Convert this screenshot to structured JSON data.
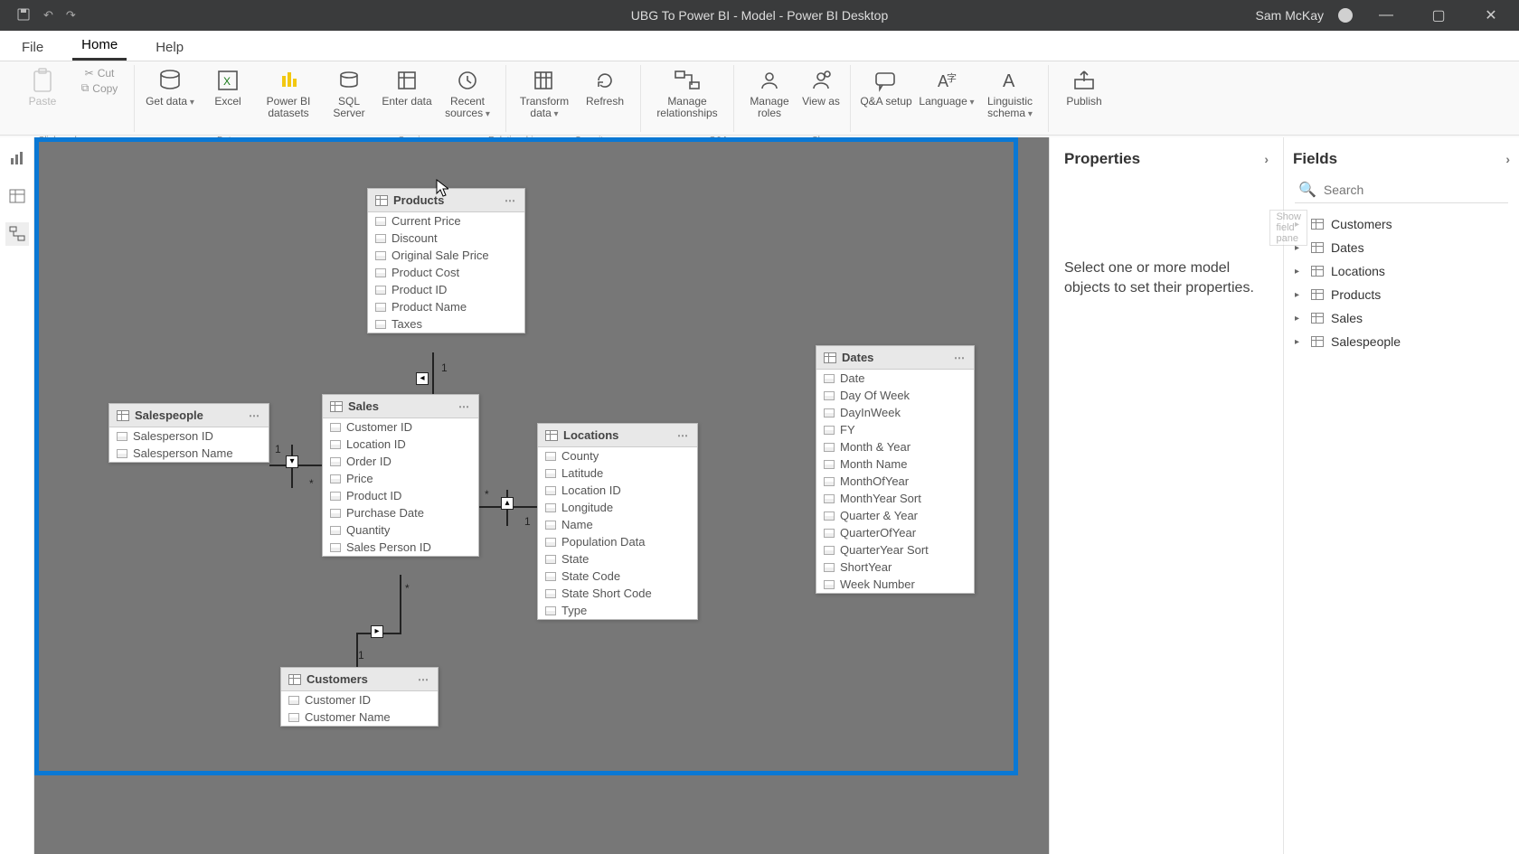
{
  "titlebar": {
    "title": "UBG To Power BI - Model - Power BI Desktop",
    "user": "Sam McKay"
  },
  "menu": {
    "file": "File",
    "home": "Home",
    "help": "Help"
  },
  "ribbon": {
    "clipboard": {
      "paste": "Paste",
      "cut": "Cut",
      "copy": "Copy"
    },
    "getdata": "Get data",
    "excel": "Excel",
    "pbdatasets": "Power BI datasets",
    "sqlserver": "SQL Server",
    "enterdata": "Enter data",
    "recentsources": "Recent sources",
    "transformdata": "Transform data",
    "refresh": "Refresh",
    "managerel": "Manage relationships",
    "manageroles": "Manage roles",
    "viewas": "View as",
    "qasetup": "Q&A setup",
    "language": "Language",
    "linguistic": "Linguistic schema",
    "publish": "Publish",
    "groups": {
      "clipboard": "Clipboard",
      "data": "Data",
      "queries": "Queries",
      "relationships": "Relationships",
      "security": "Security",
      "qa": "Q&A",
      "share": "Share"
    }
  },
  "tables": {
    "products": {
      "title": "Products",
      "fields": [
        "Current Price",
        "Discount",
        "Original Sale Price",
        "Product Cost",
        "Product ID",
        "Product Name",
        "Taxes"
      ]
    },
    "salespeople": {
      "title": "Salespeople",
      "fields": [
        "Salesperson ID",
        "Salesperson Name"
      ]
    },
    "sales": {
      "title": "Sales",
      "fields": [
        "Customer ID",
        "Location ID",
        "Order ID",
        "Price",
        "Product ID",
        "Purchase Date",
        "Quantity",
        "Sales Person ID"
      ]
    },
    "locations": {
      "title": "Locations",
      "fields": [
        "County",
        "Latitude",
        "Location ID",
        "Longitude",
        "Name",
        "Population Data",
        "State",
        "State Code",
        "State Short Code",
        "Type"
      ]
    },
    "dates": {
      "title": "Dates",
      "fields": [
        "Date",
        "Day Of Week",
        "DayInWeek",
        "FY",
        "Month & Year",
        "Month Name",
        "MonthOfYear",
        "MonthYear Sort",
        "Quarter & Year",
        "QuarterOfYear",
        "QuarterYear Sort",
        "ShortYear",
        "Week Number"
      ]
    },
    "customers": {
      "title": "Customers",
      "fields": [
        "Customer ID",
        "Customer Name"
      ]
    }
  },
  "rel_marks": {
    "one": "1",
    "many": "*"
  },
  "properties": {
    "title": "Properties",
    "body": "Select one or more model objects to set their properties."
  },
  "fields": {
    "title": "Fields",
    "search_placeholder": "Search",
    "tooltip": "Show field pane",
    "tables": [
      "Customers",
      "Dates",
      "Locations",
      "Products",
      "Sales",
      "Salespeople"
    ]
  }
}
